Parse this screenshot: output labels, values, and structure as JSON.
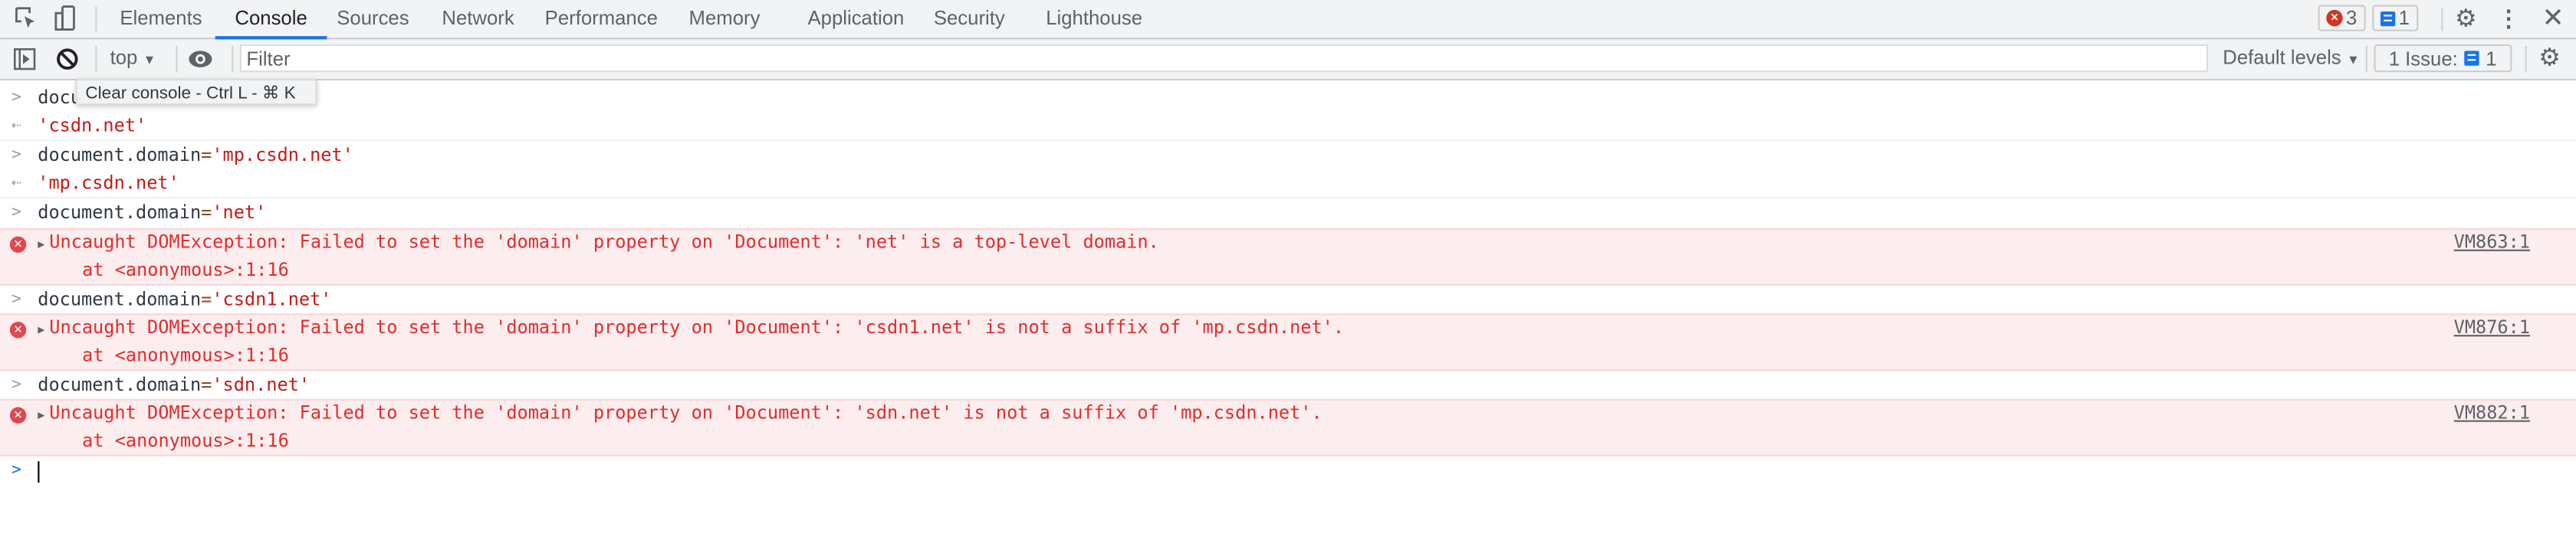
{
  "tabbar": {
    "tabs": [
      {
        "label": "Elements"
      },
      {
        "label": "Console",
        "active": true
      },
      {
        "label": "Sources"
      },
      {
        "label": "Network"
      },
      {
        "label": "Performance"
      },
      {
        "label": "Memory"
      },
      {
        "label": "Application"
      },
      {
        "label": "Security"
      },
      {
        "label": "Lighthouse"
      }
    ],
    "error_count": "3",
    "message_count": "1",
    "icons": [
      "inspect-element-icon",
      "device-toolbar-icon",
      "gear-icon",
      "kebab-menu-icon",
      "close-icon"
    ]
  },
  "toolbar": {
    "context": "top",
    "filter_placeholder": "Filter",
    "levels": "Default levels",
    "issues_label": "1 Issue:",
    "issues_count": "1",
    "tooltip": "Clear console - Ctrl L - ⌘ K"
  },
  "console": {
    "entries": [
      {
        "type": "input",
        "code": "docu"
      },
      {
        "type": "output",
        "value": "'csdn.net'"
      },
      {
        "type": "input",
        "code": "document.domain",
        "eq": "=",
        "str": "'mp.csdn.net'"
      },
      {
        "type": "output",
        "value": "'mp.csdn.net'"
      },
      {
        "type": "input",
        "code": "document.domain",
        "eq": "=",
        "str": "'net'"
      },
      {
        "type": "error",
        "message": "Uncaught DOMException: Failed to set the 'domain' property on 'Document': 'net' is a top-level domain.",
        "stack": "at <anonymous>:1:16",
        "source": "VM863:1"
      },
      {
        "type": "input",
        "code": "document.domain",
        "eq": "=",
        "str": "'csdn1.net'"
      },
      {
        "type": "error",
        "message": "Uncaught DOMException: Failed to set the 'domain' property on 'Document': 'csdn1.net' is not a suffix of 'mp.csdn.net'.",
        "stack": "at <anonymous>:1:16",
        "source": "VM876:1"
      },
      {
        "type": "input",
        "code": "document.domain",
        "eq": "=",
        "str": "'sdn.net'"
      },
      {
        "type": "error",
        "message": "Uncaught DOMException: Failed to set the 'domain' property on 'Document': 'sdn.net' is not a suffix of 'mp.csdn.net'.",
        "stack": "at <anonymous>:1:16",
        "source": "VM882:1"
      }
    ]
  },
  "colors": {
    "accent": "#1a73e8",
    "error": "#e32c2c",
    "error_bg": "#fcedee",
    "string": "#c41a16"
  }
}
